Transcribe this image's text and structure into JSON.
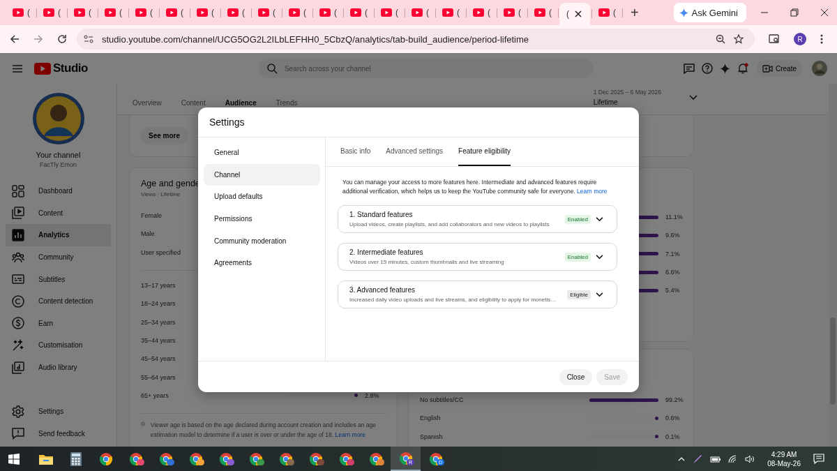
{
  "browser": {
    "tabs": [
      {
        "title": "(",
        "selected": false
      },
      {
        "title": "(",
        "selected": false
      },
      {
        "title": "(",
        "selected": false
      },
      {
        "title": "(",
        "selected": false
      },
      {
        "title": "(",
        "selected": false
      },
      {
        "title": "(",
        "selected": false
      },
      {
        "title": "(",
        "selected": false
      },
      {
        "title": "(",
        "selected": false
      },
      {
        "title": "(",
        "selected": false
      },
      {
        "title": "(",
        "selected": false
      },
      {
        "title": "(",
        "selected": false
      },
      {
        "title": "(",
        "selected": false
      },
      {
        "title": "(",
        "selected": false
      },
      {
        "title": "(",
        "selected": false
      },
      {
        "title": "(",
        "selected": false
      },
      {
        "title": "(",
        "selected": false
      },
      {
        "title": "(",
        "selected": false
      },
      {
        "title": "(",
        "selected": false
      },
      {
        "title": "(",
        "selected": true
      },
      {
        "title": "(",
        "selected": false
      }
    ],
    "new_tab": "+",
    "gemini_button": "Ask Gemini",
    "url": "studio.youtube.com/channel/UCG5OG2L2ILbLEFHH0_5CbzQ/analytics/tab-build_audience/period-lifetime",
    "profile": "R"
  },
  "studio": {
    "logo": "Studio",
    "search": {
      "placeholder": "Search across your channel"
    },
    "create_button": "Create"
  },
  "sidebar": {
    "channel_label": "Your channel",
    "channel_name": "FacTly Emon",
    "items": [
      {
        "label": "Dashboard",
        "kind": "dashboard",
        "selected": false
      },
      {
        "label": "Content",
        "kind": "content",
        "selected": false
      },
      {
        "label": "Analytics",
        "kind": "analytics",
        "selected": true
      },
      {
        "label": "Community",
        "kind": "community",
        "selected": false
      },
      {
        "label": "Subtitles",
        "kind": "subtitles",
        "selected": false
      },
      {
        "label": "Content detection",
        "kind": "copyright",
        "selected": false
      },
      {
        "label": "Earn",
        "kind": "earn",
        "selected": false
      },
      {
        "label": "Customisation",
        "kind": "customisation",
        "selected": false
      },
      {
        "label": "Audio library",
        "kind": "audio",
        "selected": false
      }
    ],
    "footer_items": [
      {
        "label": "Settings",
        "kind": "settings"
      },
      {
        "label": "Send feedback",
        "kind": "feedback"
      }
    ]
  },
  "analytics": {
    "tabs": [
      {
        "label": "Overview",
        "selected": false
      },
      {
        "label": "Content",
        "selected": false
      },
      {
        "label": "Audience",
        "selected": true
      },
      {
        "label": "Trends",
        "selected": false
      }
    ],
    "date_range": "1 Dec 2025 – 6 May 2026",
    "period": "Lifetime",
    "see_more_button": "See more",
    "age_gender": {
      "title": "Age and gende",
      "subtitle": "Views · Lifetime",
      "genders": [
        {
          "label": "Female"
        },
        {
          "label": "Male"
        },
        {
          "label": "User specified"
        }
      ],
      "ages": [
        {
          "label": "13–17 years"
        },
        {
          "label": "18–24 years"
        },
        {
          "label": "25–34 years"
        },
        {
          "label": "35–44 years"
        },
        {
          "label": "45–54 years"
        },
        {
          "label": "55–64 years"
        },
        {
          "label": "65+ years",
          "value": "2.8%",
          "level": 0.028
        }
      ],
      "note": "Viewer age is based on the age declared during account creation and includes an age estimation model to determine if a user is over or under the age of 18.",
      "note_link": "Learn more"
    },
    "right_rows": [
      {
        "value": "11.1%"
      },
      {
        "value": "9.6%"
      },
      {
        "value": "7.1%"
      },
      {
        "value": "6.6%"
      },
      {
        "value": "5.4%"
      }
    ],
    "subtitles": [
      {
        "label": "No subtitles/CC",
        "value": "99.2%",
        "level": 0.992
      },
      {
        "label": "English",
        "value": "0.6%",
        "level": 0.006
      },
      {
        "label": "Spanish",
        "value": "0.1%",
        "level": 0.001
      }
    ]
  },
  "settings_dialog": {
    "title": "Settings",
    "nav": [
      {
        "label": "General",
        "selected": false
      },
      {
        "label": "Channel",
        "selected": true
      },
      {
        "label": "Upload defaults",
        "selected": false
      },
      {
        "label": "Permissions",
        "selected": false
      },
      {
        "label": "Community moderation",
        "selected": false
      },
      {
        "label": "Agreements",
        "selected": false
      }
    ],
    "tabs": [
      {
        "label": "Basic info",
        "selected": false
      },
      {
        "label": "Advanced settings",
        "selected": false
      },
      {
        "label": "Feature eligibility",
        "selected": true
      }
    ],
    "intro": "You can manage your access to more features here. Intermediate and advanced features require additional verification, which helps us to keep the YouTube community safe for everyone.",
    "intro_link": "Learn more",
    "features": [
      {
        "title": "1. Standard features",
        "description": "Upload videos, create playlists, and add collaborators and new videos to playlists",
        "badge": "Enabled",
        "kind": "enabled"
      },
      {
        "title": "2. Intermediate features",
        "description": "Videos over 15 minutes, custom thumbnails and live streaming",
        "badge": "Enabled",
        "kind": "enabled"
      },
      {
        "title": "3. Advanced features",
        "description": "Increased daily video uploads and live streams, and eligibility to apply for monetis…",
        "badge": "Eligible",
        "kind": "eligible"
      }
    ],
    "close_button": "Close",
    "save_button": {
      "label": "Save",
      "disabled": true
    }
  },
  "taskbar": {
    "apps": [
      {
        "kind": "explorer",
        "selected": false
      },
      {
        "kind": "calculator",
        "selected": false
      },
      {
        "kind": "chrome",
        "selected": false
      },
      {
        "kind": "chrome",
        "color": "#e84a6f",
        "selected": false
      },
      {
        "kind": "chrome",
        "color": "#2f6fd6",
        "selected": false
      },
      {
        "kind": "chrome",
        "color": "#f2a33a",
        "selected": false
      },
      {
        "kind": "chrome",
        "color": "#8a5cd0",
        "selected": false
      },
      {
        "kind": "chrome",
        "color": "#3c9a4a",
        "selected": false
      },
      {
        "kind": "chrome",
        "color": "#8a6a4a",
        "selected": false
      },
      {
        "kind": "chrome",
        "color": "#7a4a3a",
        "selected": false
      },
      {
        "kind": "chrome",
        "color": "#d0406a",
        "selected": false
      },
      {
        "kind": "chrome",
        "color": "#e0843a",
        "selected": false
      },
      {
        "kind": "chrome",
        "color": "#5b3fb0",
        "badge": "R",
        "selected": true
      },
      {
        "kind": "chrome",
        "color": "#1a73e8",
        "badge": "D",
        "selected": false
      }
    ],
    "time": "4:29 AM",
    "date": "08-May-26"
  }
}
